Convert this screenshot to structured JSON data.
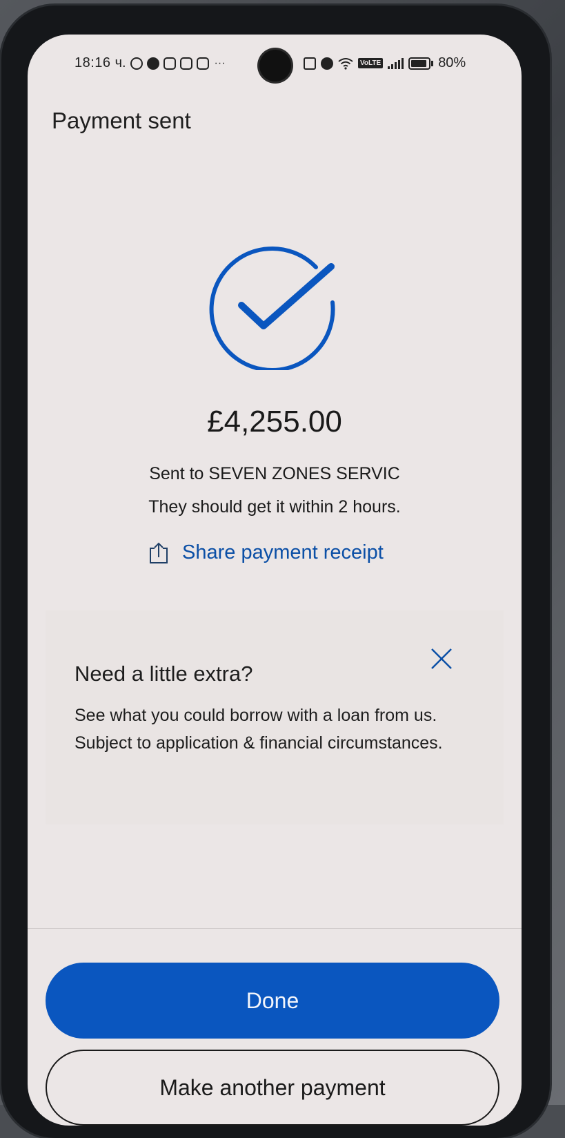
{
  "status_bar": {
    "time": "18:16",
    "carrier_suffix": "ч.",
    "more": "···",
    "volte": "VoLTE",
    "battery": "80%"
  },
  "header": {
    "title": "Payment sent"
  },
  "confirmation": {
    "amount": "£4,255.00",
    "recipient_line": "Sent to SEVEN ZONES SERVIC",
    "eta_line": "They should get it within 2 hours.",
    "share_label": "Share payment receipt"
  },
  "promo": {
    "title": "Need a little extra?",
    "body": "See what you could borrow with a loan from us. Subject to application & financial circumstances."
  },
  "actions": {
    "done_label": "Done",
    "another_label": "Make another payment"
  },
  "colors": {
    "accent": "#0a56bf",
    "link": "#0b4fa6"
  },
  "icons": {
    "check": "check-circle-icon",
    "share": "share-icon",
    "close": "close-icon"
  }
}
